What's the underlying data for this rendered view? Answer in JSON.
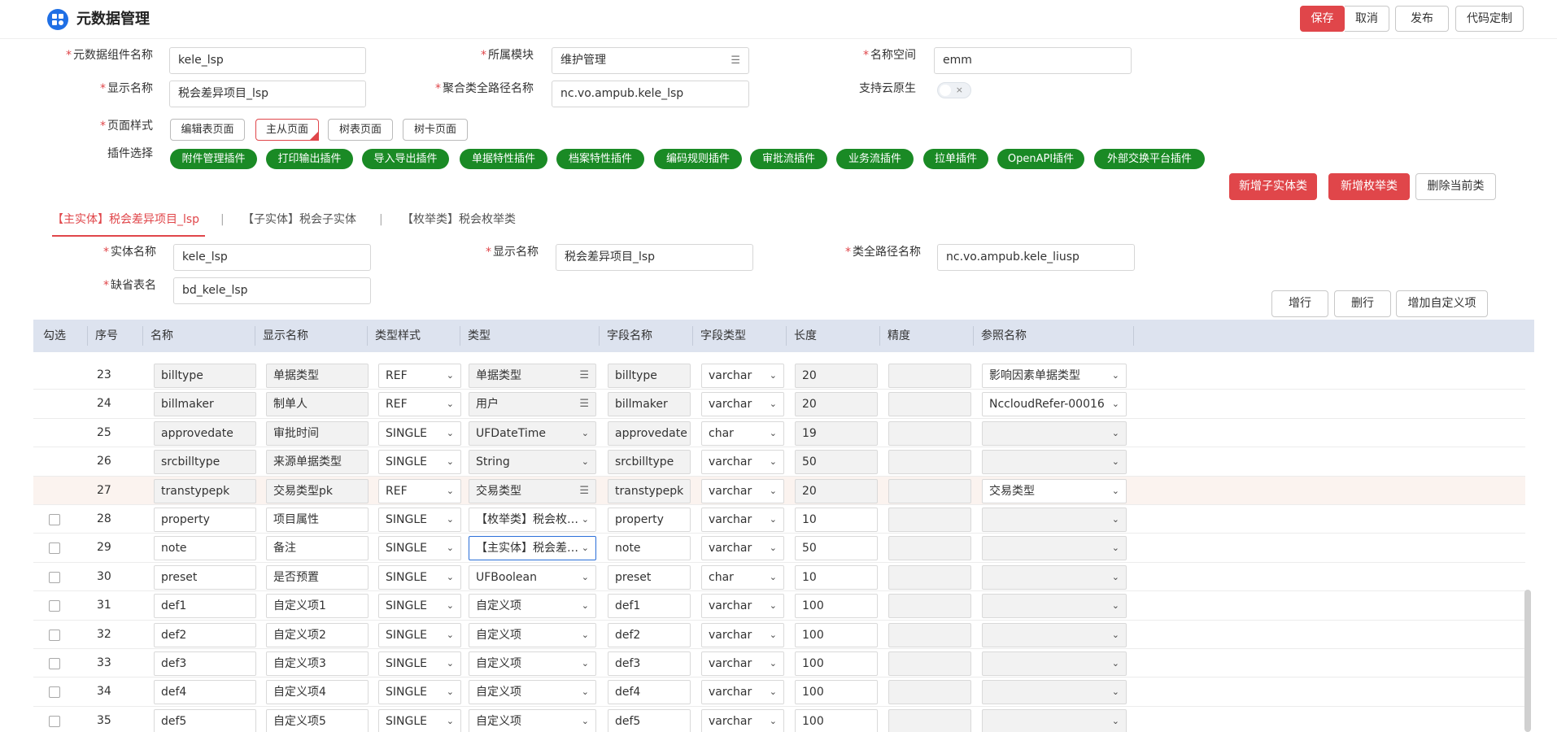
{
  "header": {
    "title": "元数据管理",
    "buttons": {
      "save": "保存",
      "cancel": "取消",
      "publish": "发布",
      "codegen": "代码定制"
    }
  },
  "form": {
    "component_name": {
      "label": "元数据组件名称",
      "value": "kele_lsp"
    },
    "module": {
      "label": "所属模块",
      "value": "维护管理"
    },
    "namespace": {
      "label": "名称空间",
      "value": "emm"
    },
    "display_name": {
      "label": "显示名称",
      "value": "税会差异项目_lsp"
    },
    "aggregate_path": {
      "label": "聚合类全路径名称",
      "value": "nc.vo.ampub.kele_lsp"
    },
    "cloud_native": {
      "label": "支持云原生",
      "value": "×"
    },
    "page_style": {
      "label": "页面样式",
      "options": [
        "编辑表页面",
        "主从页面",
        "树表页面",
        "树卡页面"
      ],
      "selected": "主从页面"
    },
    "plugins": {
      "label": "插件选择",
      "items": [
        "附件管理插件",
        "打印输出插件",
        "导入导出插件",
        "单据特性插件",
        "档案特性插件",
        "编码规则插件",
        "审批流插件",
        "业务流插件",
        "拉单插件",
        "OpenAPI插件",
        "外部交换平台插件"
      ]
    }
  },
  "class_actions": {
    "add_child": "新增子实体类",
    "add_enum": "新增枚举类",
    "delete": "删除当前类"
  },
  "tabs": {
    "items": [
      "【主实体】税会差异项目_lsp",
      "【子实体】税会子实体",
      "【枚举类】税会枚举类"
    ],
    "separator": "|",
    "active": 0
  },
  "entity": {
    "entity_name": {
      "label": "实体名称",
      "value": "kele_lsp"
    },
    "display_name": {
      "label": "显示名称",
      "value": "税会差异项目_lsp"
    },
    "class_path": {
      "label": "类全路径名称",
      "value": "nc.vo.ampub.kele_liusp"
    },
    "table_name": {
      "label": "缺省表名",
      "value": "bd_kele_lsp"
    }
  },
  "table_actions": {
    "add_row": "增行",
    "delete_row": "删行",
    "add_custom": "增加自定义项"
  },
  "table": {
    "columns": [
      "勾选",
      "序号",
      "名称",
      "显示名称",
      "类型样式",
      "类型",
      "字段名称",
      "字段类型",
      "长度",
      "精度",
      "参照名称"
    ],
    "rows": [
      {
        "no": "23",
        "name": "billtype",
        "display": "单据类型",
        "style": "REF",
        "type": "单据类型",
        "field": "billtype",
        "ftype": "varchar",
        "len": "20",
        "prec": "",
        "ref": "影响因素单据类型",
        "checkbox": false,
        "locked": true,
        "type_list": true
      },
      {
        "no": "24",
        "name": "billmaker",
        "display": "制单人",
        "style": "REF",
        "type": "用户",
        "field": "billmaker",
        "ftype": "varchar",
        "len": "20",
        "prec": "",
        "ref": "NccloudRefer-00016",
        "checkbox": false,
        "locked": true,
        "type_list": true
      },
      {
        "no": "25",
        "name": "approvedate",
        "display": "审批时间",
        "style": "SINGLE",
        "type": "UFDateTime",
        "field": "approvedate",
        "ftype": "char",
        "len": "19",
        "prec": "",
        "ref": "",
        "checkbox": false,
        "locked": true,
        "type_list": false
      },
      {
        "no": "26",
        "name": "srcbilltype",
        "display": "来源单据类型",
        "style": "SINGLE",
        "type": "String",
        "field": "srcbilltype",
        "ftype": "varchar",
        "len": "50",
        "prec": "",
        "ref": "",
        "checkbox": false,
        "locked": true,
        "type_list": false
      },
      {
        "no": "27",
        "name": "transtypepk",
        "display": "交易类型pk",
        "style": "REF",
        "type": "交易类型",
        "field": "transtypepk",
        "ftype": "varchar",
        "len": "20",
        "prec": "",
        "ref": "交易类型",
        "checkbox": false,
        "locked": true,
        "type_list": true,
        "highlight": true
      },
      {
        "no": "28",
        "name": "property",
        "display": "项目属性",
        "style": "SINGLE",
        "type": "【枚举类】税会枚举类",
        "field": "property",
        "ftype": "varchar",
        "len": "10",
        "prec": "",
        "ref": "",
        "checkbox": true,
        "locked": false,
        "type_list": false
      },
      {
        "no": "29",
        "name": "note",
        "display": "备注",
        "style": "SINGLE",
        "type": "【主实体】税会差异项目_lsp",
        "field": "note",
        "ftype": "varchar",
        "len": "50",
        "prec": "",
        "ref": "",
        "checkbox": true,
        "locked": false,
        "type_list": false,
        "focus": true
      },
      {
        "no": "30",
        "name": "preset",
        "display": "是否预置",
        "style": "SINGLE",
        "type": "UFBoolean",
        "field": "preset",
        "ftype": "char",
        "len": "10",
        "prec": "",
        "ref": "",
        "checkbox": true,
        "locked": false,
        "type_list": false
      },
      {
        "no": "31",
        "name": "def1",
        "display": "自定义项1",
        "style": "SINGLE",
        "type": "自定义项",
        "field": "def1",
        "ftype": "varchar",
        "len": "100",
        "prec": "",
        "ref": "",
        "checkbox": true,
        "locked": false,
        "type_list": false
      },
      {
        "no": "32",
        "name": "def2",
        "display": "自定义项2",
        "style": "SINGLE",
        "type": "自定义项",
        "field": "def2",
        "ftype": "varchar",
        "len": "100",
        "prec": "",
        "ref": "",
        "checkbox": true,
        "locked": false,
        "type_list": false
      },
      {
        "no": "33",
        "name": "def3",
        "display": "自定义项3",
        "style": "SINGLE",
        "type": "自定义项",
        "field": "def3",
        "ftype": "varchar",
        "len": "100",
        "prec": "",
        "ref": "",
        "checkbox": true,
        "locked": false,
        "type_list": false
      },
      {
        "no": "34",
        "name": "def4",
        "display": "自定义项4",
        "style": "SINGLE",
        "type": "自定义项",
        "field": "def4",
        "ftype": "varchar",
        "len": "100",
        "prec": "",
        "ref": "",
        "checkbox": true,
        "locked": false,
        "type_list": false
      },
      {
        "no": "35",
        "name": "def5",
        "display": "自定义项5",
        "style": "SINGLE",
        "type": "自定义项",
        "field": "def5",
        "ftype": "varchar",
        "len": "100",
        "prec": "",
        "ref": "",
        "checkbox": true,
        "locked": false,
        "type_list": false
      }
    ]
  },
  "icons": {
    "chevron": "chevron-down-icon",
    "list": "list-icon",
    "logo": "app-grid-icon"
  },
  "colors": {
    "primary_red": "#e0464a",
    "plugin_green": "#1a8a25",
    "header_blue": "#1f6fe5",
    "table_header_bg": "#dde3ef"
  }
}
